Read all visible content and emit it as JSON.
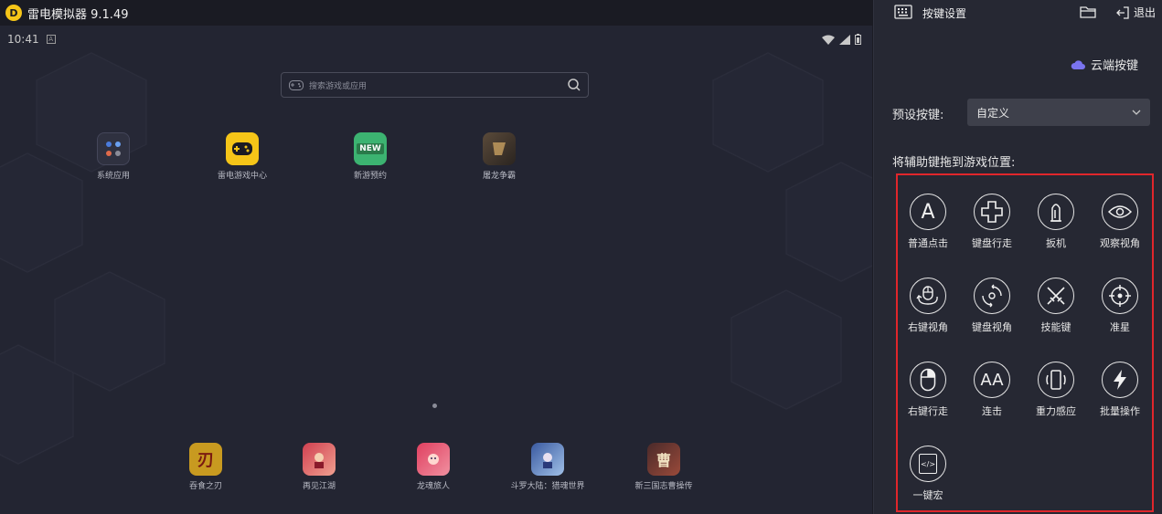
{
  "titlebar": {
    "logo_glyph": "D",
    "title": "雷电模拟器 9.1.49"
  },
  "statusbar": {
    "time": "10:41",
    "notify_glyph": "A"
  },
  "search": {
    "placeholder": "搜索游戏或应用",
    "icon": "search-icon"
  },
  "desktop_apps": [
    {
      "label": "系统应用",
      "icon": "system-apps-folder-icon"
    },
    {
      "label": "雷电游戏中心",
      "icon": "gamepad-icon"
    },
    {
      "label": "新游预约",
      "icon": "new-badge-icon",
      "badge": "NEW"
    },
    {
      "label": "屠龙争霸",
      "icon": "game-tulong-icon"
    }
  ],
  "dock_apps": [
    {
      "label": "吞食之刃",
      "icon": "game-blade-icon",
      "glyph": "刃"
    },
    {
      "label": "再见江湖",
      "icon": "game-jianghu-icon"
    },
    {
      "label": "龙魂旅人",
      "icon": "game-longhun-icon"
    },
    {
      "label": "斗罗大陆：猎魂世界",
      "icon": "game-douluo-icon"
    },
    {
      "label": "新三国志曹操传",
      "icon": "game-caocao-icon",
      "glyph": "曹"
    }
  ],
  "panel": {
    "title": "按键设置",
    "exit_label": "退出",
    "cloud_label": "云端按键",
    "preset_label": "预设按键:",
    "preset_value": "自定义",
    "drag_hint": "将辅助键拖到游戏位置:",
    "accent_color": "#e0262b",
    "cloud_color": "#7a74f0"
  },
  "tools": [
    {
      "label": "普通点击",
      "icon": "letter-a-icon",
      "glyph": "A"
    },
    {
      "label": "键盘行走",
      "icon": "dpad-cross-icon"
    },
    {
      "label": "扳机",
      "icon": "trigger-bullet-icon"
    },
    {
      "label": "观察视角",
      "icon": "eye-icon"
    },
    {
      "label": "右键视角",
      "icon": "mouse-rotate-icon"
    },
    {
      "label": "键盘视角",
      "icon": "keyboard-rotate-icon"
    },
    {
      "label": "技能键",
      "icon": "crossed-swords-icon"
    },
    {
      "label": "准星",
      "icon": "crosshair-icon"
    },
    {
      "label": "右键行走",
      "icon": "mouse-icon"
    },
    {
      "label": "连击",
      "icon": "double-a-icon",
      "glyph": "AA"
    },
    {
      "label": "重力感应",
      "icon": "phone-tilt-icon"
    },
    {
      "label": "批量操作",
      "icon": "lightning-icon"
    },
    {
      "label": "一键宏",
      "icon": "macro-code-icon",
      "glyph": "</>"
    }
  ]
}
